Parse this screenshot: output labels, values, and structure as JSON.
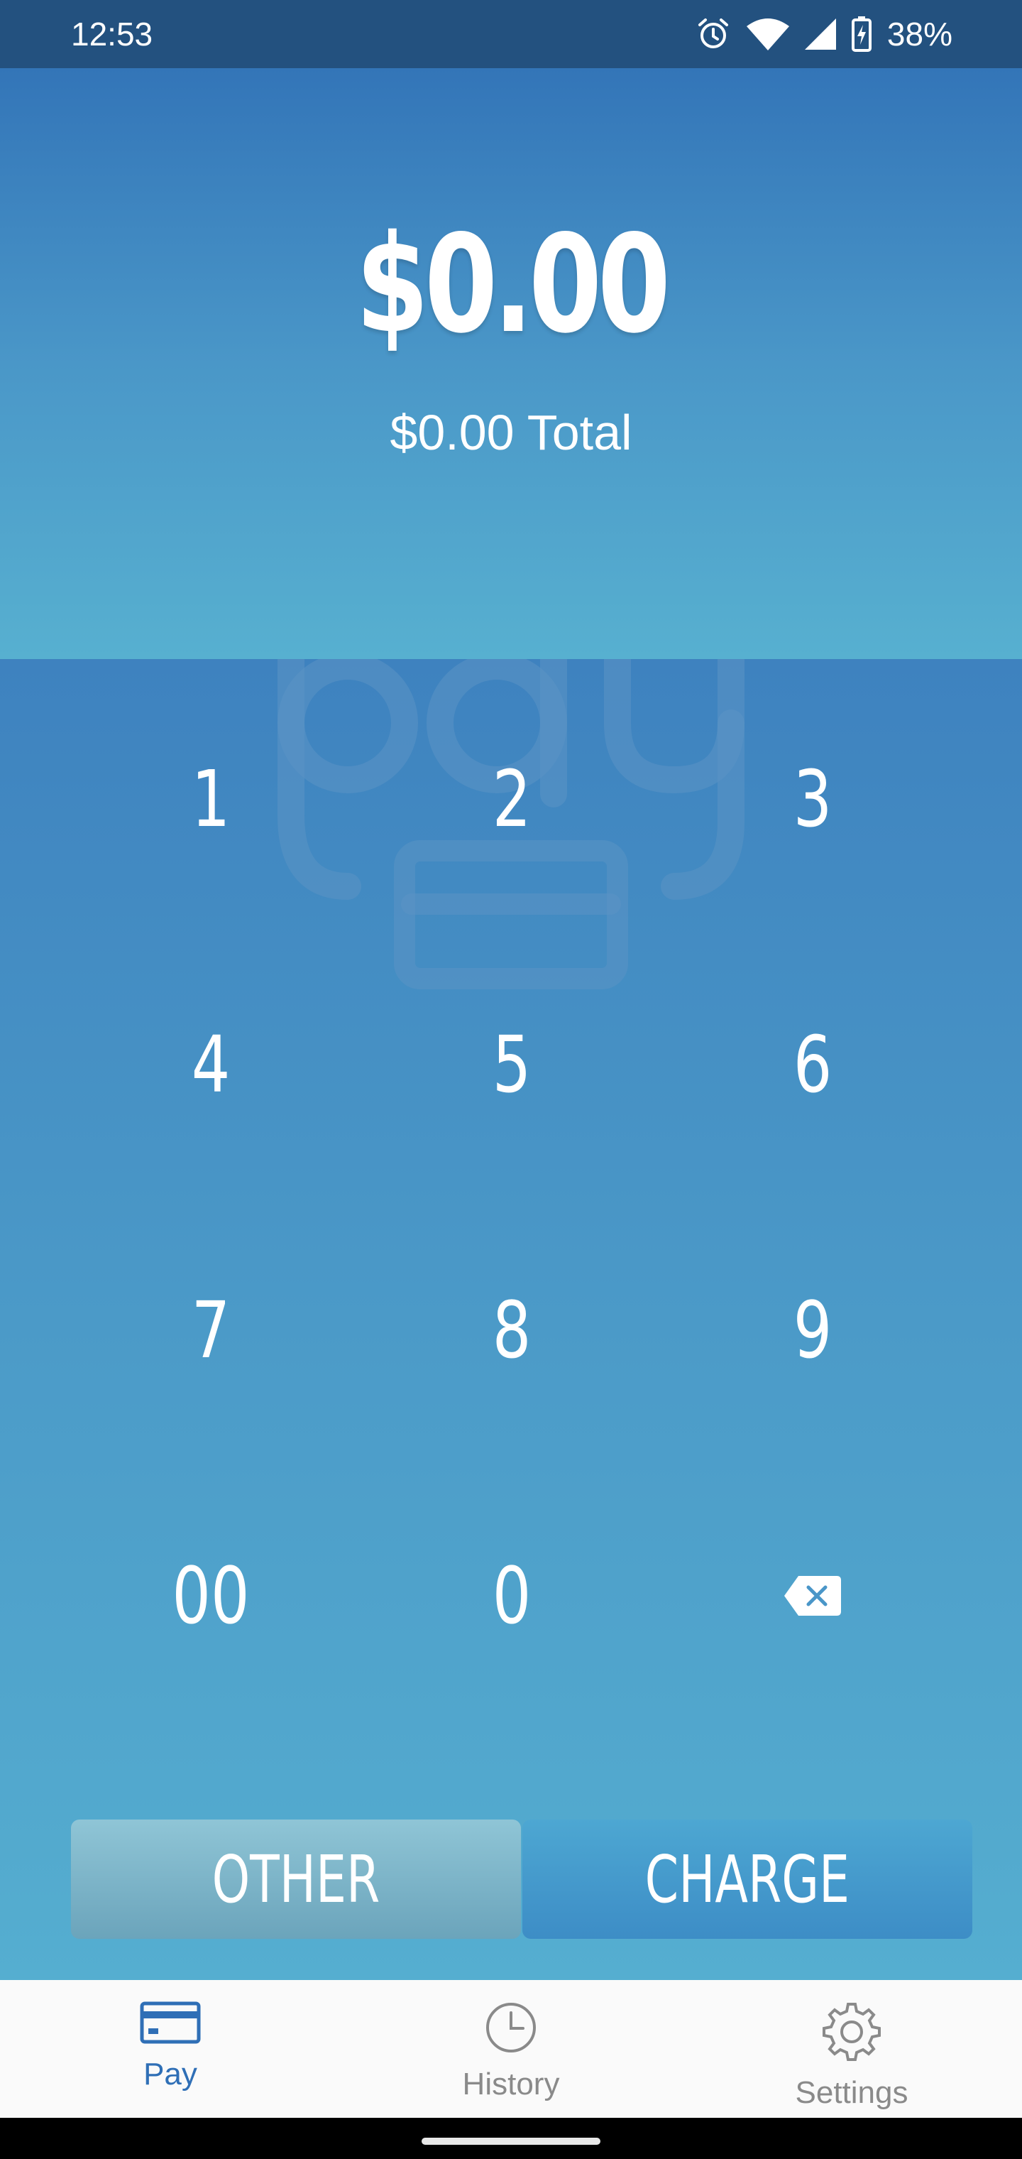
{
  "status_bar": {
    "time": "12:53",
    "battery": "38%",
    "icons": [
      "alarm-icon",
      "wifi-icon",
      "signal-icon",
      "battery-charging-icon"
    ]
  },
  "amount": {
    "value": "$0.00",
    "total_label": "$0.00 Total"
  },
  "keypad": {
    "keys": [
      "1",
      "2",
      "3",
      "4",
      "5",
      "6",
      "7",
      "8",
      "9",
      "00",
      "0"
    ],
    "backspace_icon": "backspace-icon"
  },
  "actions": {
    "other_label": "OTHER",
    "charge_label": "CHARGE"
  },
  "nav": {
    "items": [
      {
        "label": "Pay",
        "icon": "credit-card-icon",
        "active": true
      },
      {
        "label": "History",
        "icon": "clock-icon",
        "active": false
      },
      {
        "label": "Settings",
        "icon": "gear-icon",
        "active": false
      }
    ]
  },
  "colors": {
    "status_bar": "#23517f",
    "header_top": "#3375b8",
    "header_bottom": "#57b0d0",
    "active_nav": "#2f6fb6",
    "inactive_nav": "#8a8a8a"
  }
}
